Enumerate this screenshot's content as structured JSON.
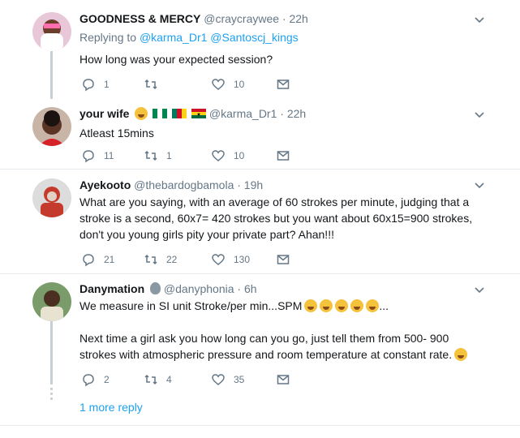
{
  "tweets": [
    {
      "name": "GOODNESS & MERCY",
      "handle": "@craycraywee",
      "time": "· 22h",
      "replying_prefix": "Replying to",
      "replying_users": [
        "@karma_Dr1",
        "@Santoscj_kings"
      ],
      "text": [
        "How long was your expected session?"
      ],
      "replies": "1",
      "retweets": "",
      "likes": "10"
    },
    {
      "name": "your wife",
      "handle": "@karma_Dr1",
      "time": "· 22h",
      "text": [
        "Atleast 15mins"
      ],
      "replies": "11",
      "retweets": "1",
      "likes": "10"
    },
    {
      "name": "Ayekooto",
      "handle": "@thebardogbamola",
      "time": "· 19h",
      "text": [
        "What are you saying, with an average of 60 strokes per minute, judging that a stroke is a second, 60x7= 420 strokes but you want about 60x15=900 strokes, don't you young girls pity your private part? Ahan!!!"
      ],
      "replies": "21",
      "retweets": "22",
      "likes": "130"
    },
    {
      "name": "Danymation",
      "handle": "@danyphonia",
      "time": "· 6h",
      "text": [
        "We measure in SI unit Stroke/per min...SPM",
        "...",
        "Next time a girl ask you how long can you go, just tell them from 500- 900 strokes with atmospheric pressure and room temperature at constant rate."
      ],
      "replies": "2",
      "retweets": "4",
      "likes": "35"
    }
  ],
  "more_replies": "1 more reply",
  "colors": {
    "link": "#1da1f2",
    "muted": "#657786",
    "thread": "#c4cfd6"
  }
}
